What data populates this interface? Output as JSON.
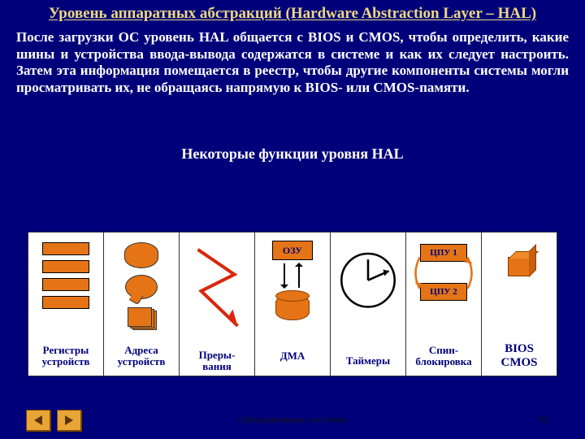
{
  "title": "Уровень аппаратных абстракций (Hardware Abstraction Layer – HAL)",
  "paragraph": "После загрузки ОС уровень HAL общается с BIOS и CMOS, чтобы определить, какие шины и устройства ввода-вывода содержатся в системе и как их следует настроить. Затем эта информация помещается в реестр, чтобы другие компоненты системы могли просматривать их, не обращаясь напрямую к BIOS- или CMOS-памяти.",
  "subtitle": "Некоторые функции уровня HAL",
  "cells": {
    "registers": "Регистры устройств",
    "addresses": "Адреса устройств",
    "interrupts": "Преры-\nвания",
    "dma": "ДМА",
    "timers": "Таймеры",
    "spinlock": "Спин-\nблокировка",
    "bios": "BIOS\nCMOS"
  },
  "labels": {
    "ram": "ОЗУ",
    "cpu1": "ЦПУ 1",
    "cpu2": "ЦПУ 2"
  },
  "footer": "Операционные системы",
  "page": "95",
  "icons": {
    "prev": "prev-icon",
    "next": "next-icon"
  },
  "colors": {
    "accent": "#e47416",
    "bg": "#00007b",
    "title": "#eed97a"
  }
}
